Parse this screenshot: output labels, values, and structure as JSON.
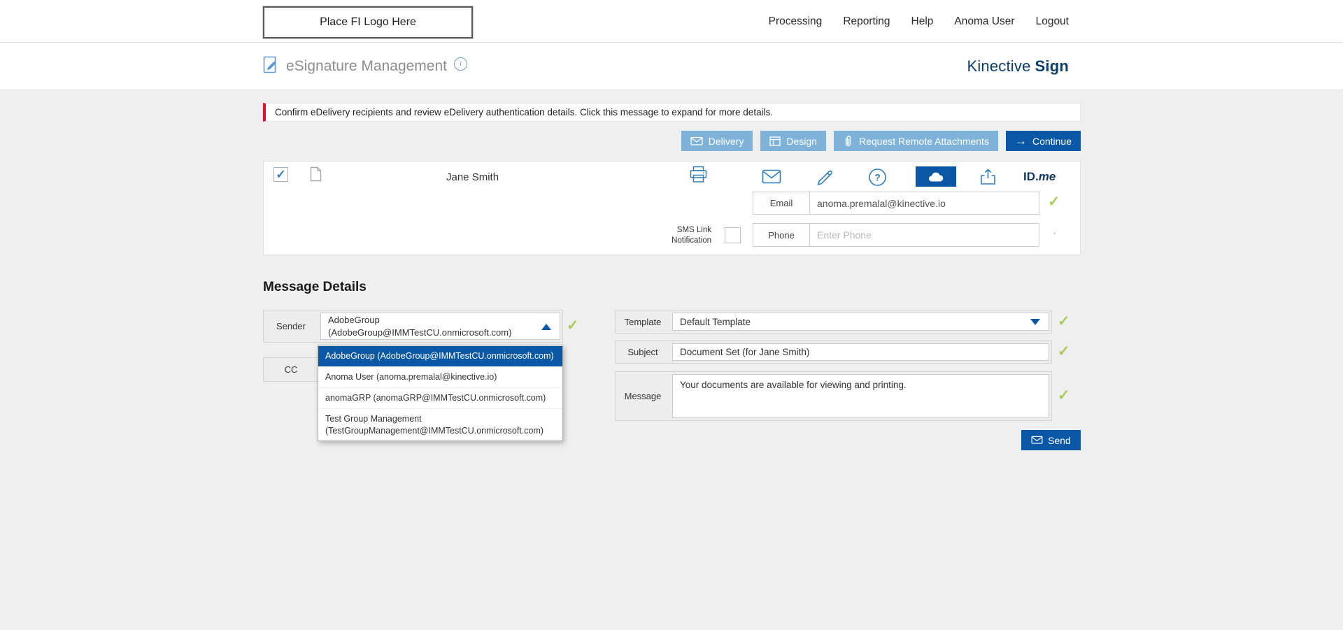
{
  "header": {
    "logo_text": "Place FI Logo Here",
    "nav_items": [
      {
        "label": "Processing"
      },
      {
        "label": "Reporting"
      },
      {
        "label": "Help"
      },
      {
        "label": "Anoma User"
      },
      {
        "label": "Logout"
      }
    ]
  },
  "subheader": {
    "title": "eSignature Management",
    "brand_first": "Kinective",
    "brand_second": "Sign"
  },
  "alert": {
    "text": "Confirm eDelivery recipients and review eDelivery authentication details. Click this message to expand for more details."
  },
  "toolbar": {
    "delivery_label": "Delivery",
    "design_label": "Design",
    "attachments_label": "Request Remote Attachments",
    "continue_label": "Continue",
    "continue_arrow": "→"
  },
  "recipient": {
    "name": "Jane Smith",
    "selected": true,
    "email_label": "Email",
    "email_value": "anoma.premalal@kinective.io",
    "sms_label_line1": "SMS Link",
    "sms_label_line2": "Notification",
    "phone_label": "Phone",
    "phone_placeholder": "Enter Phone",
    "phone_indicator": "·",
    "check_glyph": "✓",
    "idme_id": "ID.",
    "idme_me": "me",
    "auth_methods": [
      {
        "name": "email",
        "selected": false
      },
      {
        "name": "signature",
        "selected": false
      },
      {
        "name": "security-question",
        "selected": false
      },
      {
        "name": "cloud",
        "selected": true
      },
      {
        "name": "remote-attachment",
        "selected": false
      },
      {
        "name": "idme",
        "selected": false
      }
    ]
  },
  "message_details": {
    "heading": "Message Details",
    "sender_label": "Sender",
    "sender_value": "AdobeGroup (AdobeGroup@IMMTestCU.onmicrosoft.com)",
    "sender_options": [
      {
        "label": "AdobeGroup (AdobeGroup@IMMTestCU.onmicrosoft.com)",
        "selected": true
      },
      {
        "label": "Anoma User (anoma.premalal@kinective.io)",
        "selected": false
      },
      {
        "label": "anomaGRP (anomaGRP@IMMTestCU.onmicrosoft.com)",
        "selected": false
      },
      {
        "label": "Test Group Management (TestGroupManagement@IMMTestCU.onmicrosoft.com)",
        "selected": false
      }
    ],
    "cc_label": "CC",
    "template_label": "Template",
    "template_value": "Default Template",
    "subject_label": "Subject",
    "subject_value": "Document Set (for Jane Smith)",
    "message_label": "Message",
    "message_value": "Your documents are available for viewing and printing.",
    "send_label": "Send"
  },
  "colors": {
    "primary_blue": "#0a58a5",
    "light_blue_button": "#7fb2d9",
    "brand_navy": "#0d3e66",
    "alert_red": "#e8112d",
    "check_green": "#a9cb55",
    "page_background": "#efefef"
  }
}
